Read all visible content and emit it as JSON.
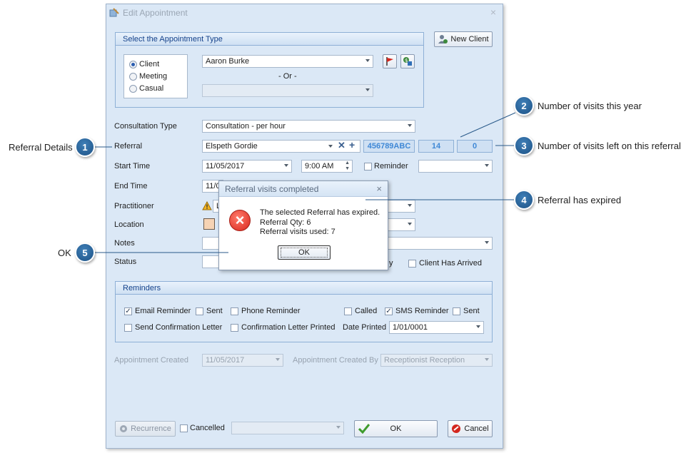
{
  "dialog": {
    "title": "Edit Appointment",
    "close": "×"
  },
  "appointment_type": {
    "header": "Select the Appointment Type",
    "options": [
      "Client",
      "Meeting",
      "Casual"
    ],
    "selected": "Client",
    "client_value": "Aaron Burke",
    "or_label": "- Or -",
    "new_client_label": "New Client"
  },
  "form": {
    "consultation_type_label": "Consultation Type",
    "consultation_type_value": "Consultation - per hour",
    "referral_label": "Referral",
    "referral_value": "Elspeth Gordie",
    "referral_code": "456789ABC",
    "visits_this_year": "14",
    "visits_left": "0",
    "start_time_label": "Start Time",
    "start_date": "11/05/2017",
    "start_time": "9:00 AM",
    "reminder_label": "Reminder",
    "end_time_label": "End Time",
    "end_date_partial": "11/0",
    "practitioner_label": "Practitioner",
    "practitioner_partial": "L",
    "location_label": "Location",
    "notes_label": "Notes",
    "status_label": "Status",
    "status_partial_right": "y",
    "client_arrived_label": "Client Has Arrived"
  },
  "reminders": {
    "header": "Reminders",
    "email_reminder": "Email Reminder",
    "sent": "Sent",
    "phone_reminder": "Phone Reminder",
    "called": "Called",
    "sms_reminder": "SMS Reminder",
    "send_confirmation": "Send Confirmation Letter",
    "confirmation_printed": "Confirmation Letter Printed",
    "date_printed_label": "Date Printed",
    "date_printed_value": "1/01/0001"
  },
  "created": {
    "created_label": "Appointment Created",
    "created_value": "11/05/2017",
    "created_by_label": "Appointment Created By",
    "created_by_value": "Receptionist Reception"
  },
  "footer": {
    "recurrence": "Recurrence",
    "cancelled": "Cancelled",
    "ok": "OK",
    "cancel": "Cancel"
  },
  "message_box": {
    "title": "Referral visits completed",
    "close": "×",
    "line1": "The selected Referral has expired.",
    "line2": "Referral Qty: 6",
    "line3": "Referral visits used: 7",
    "ok": "OK"
  },
  "callouts": [
    {
      "number": "1",
      "text": "Referral Details"
    },
    {
      "number": "2",
      "text": "Number of visits this year"
    },
    {
      "number": "3",
      "text": "Number of visits left on this referral"
    },
    {
      "number": "4",
      "text": "Referral has expired"
    },
    {
      "number": "5",
      "text": "OK"
    }
  ],
  "colors": {
    "dialog_bg": "#dbe8f6",
    "group_header_text": "#15428b",
    "callout_blue": "#1d5286",
    "referral_code_text": "#3f88d6"
  }
}
